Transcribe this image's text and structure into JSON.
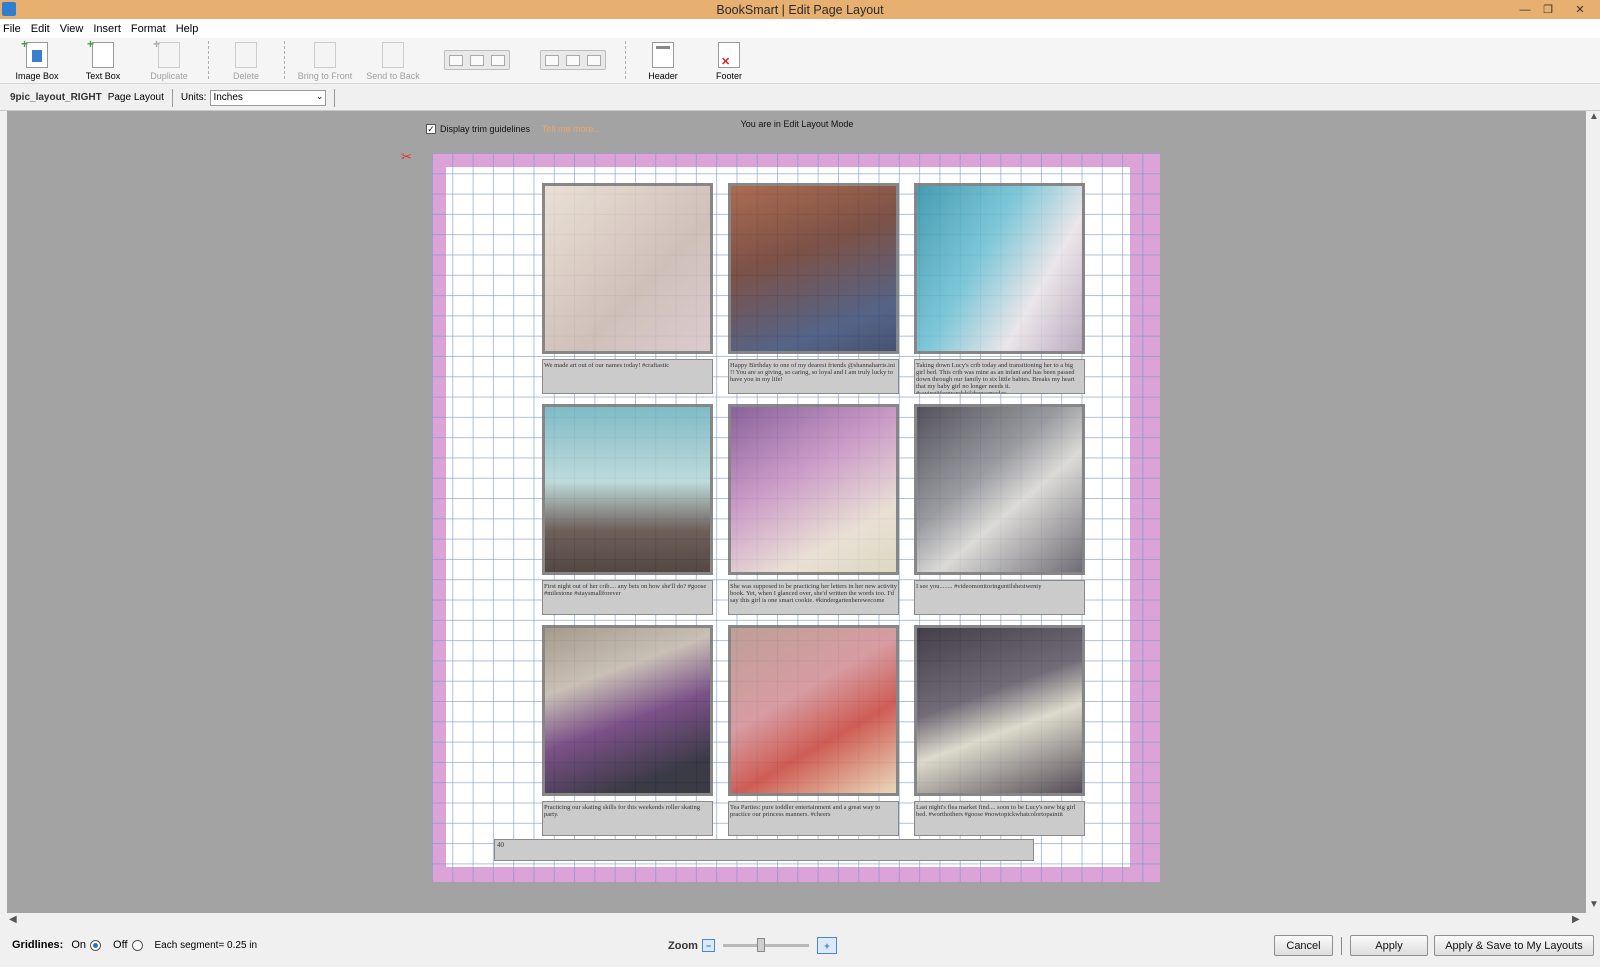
{
  "window": {
    "title": "BookSmart | Edit Page Layout"
  },
  "menu": [
    "File",
    "Edit",
    "View",
    "Insert",
    "Format",
    "Help"
  ],
  "toolbar": {
    "image_box": "Image Box",
    "text_box": "Text Box",
    "duplicate": "Duplicate",
    "delete": "Delete",
    "bring_to_front": "Bring to Front",
    "send_to_back": "Send to Back",
    "header": "Header",
    "footer": "Footer"
  },
  "options": {
    "layout_name": "9pic_layout_RIGHT",
    "layout_type": "Page Layout",
    "units_label": "Units:",
    "units_value": "Inches"
  },
  "canvas": {
    "trim_label": "Display trim guidelines",
    "tell_more": "Tell me more...",
    "mode_text": "You are in Edit Layout Mode",
    "page_number": "40",
    "captions": [
      "We made art out of our names today! #craftastic",
      "Happy Birthday to one of my dearest friends @shannaharris.ini !! You are so giving, so caring, so loyal and I am truly lucky to have you in my life!",
      "Taking down Lucy's crib today and transitioning her to a big girl bed. This crib was mine as an infant and has been passed down through our family to six little babies. Breaks my heart that my baby girl no longer needs it. #savingitforgrandchildrensomeday",
      "First night out of her crib.... any bets on how she'll do? #goose #milestone #staysmallforever",
      "She was supposed to be practicing her letters in her new activity book. Yet, when I glanced over, she'd written the words too. I'd say this girl is one smart cookie. #kindergartenherewecome",
      "I see you........ #videomonitoringuntilshestwenty",
      "Practicing our skating skills for this weekends roller skating party.",
      "Tea Parties: pure toddler entertainment and a great way to practice our princess manners. #cheers",
      "Last night's flea market find.... soon to be Lucy's new big girl bed. #worthothers #goose #nowtopickwhatcolortopaintit"
    ]
  },
  "bottom": {
    "gridlines_label": "Gridlines:",
    "on_label": "On",
    "off_label": "Off",
    "segment_text": "Each segment= 0.25 in",
    "zoom_label": "Zoom",
    "cancel": "Cancel",
    "apply": "Apply",
    "apply_save": "Apply & Save to My Layouts"
  },
  "colors": {
    "titlebar": "#e8b070",
    "page_bleed": "#dba3d7",
    "accent": "#2a6fcf"
  },
  "icons": [
    "image-box-icon",
    "text-box-icon",
    "duplicate-icon",
    "delete-icon",
    "bring-to-front-icon",
    "send-to-back-icon",
    "header-icon",
    "footer-icon",
    "scissors-icon",
    "zoom-out-icon",
    "zoom-in-icon"
  ]
}
